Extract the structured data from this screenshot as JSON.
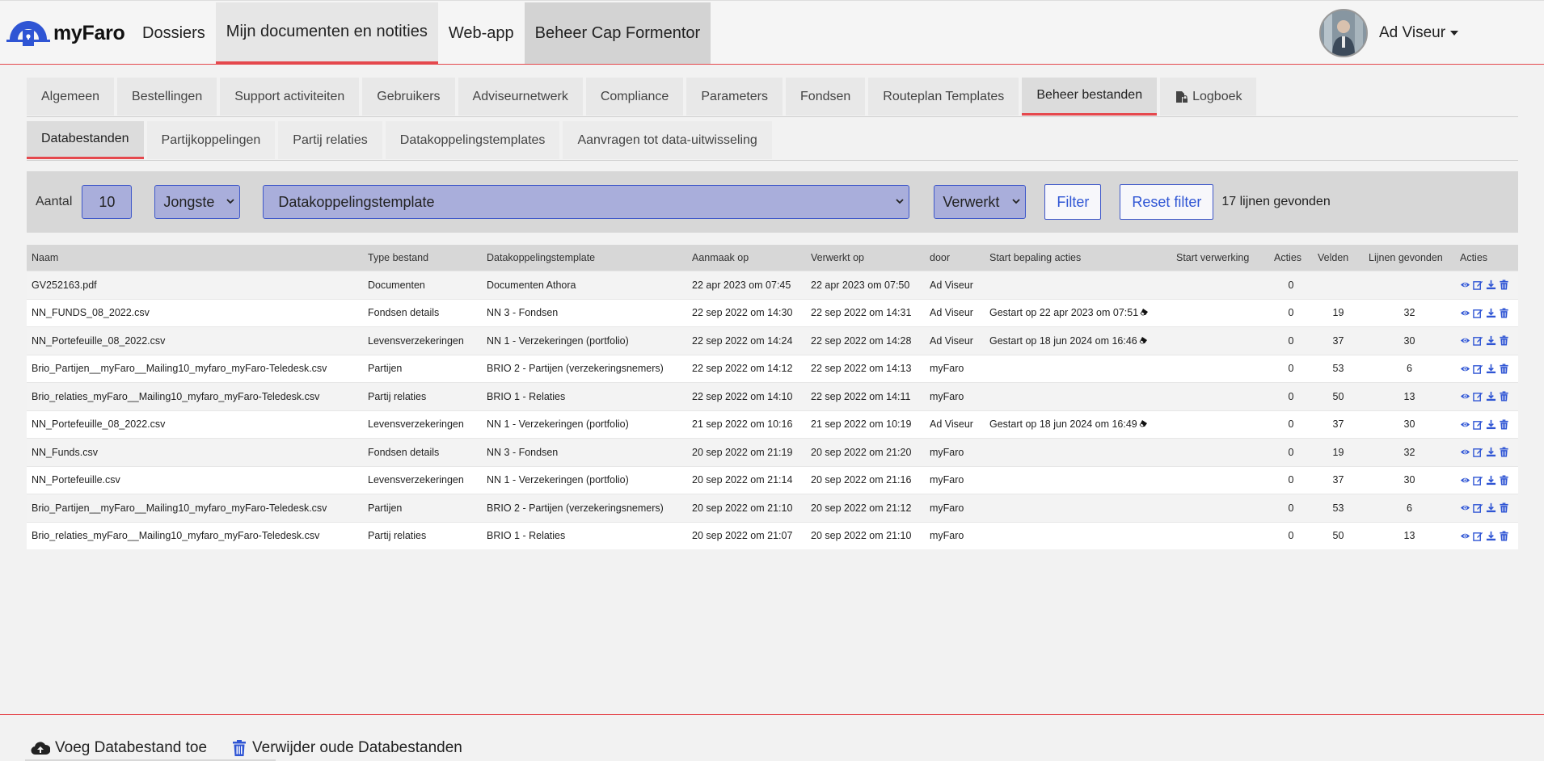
{
  "brand": {
    "name": "myFaro"
  },
  "topnav": {
    "items": [
      "Dossiers",
      "Mijn documenten en notities",
      "Web-app",
      "Beheer Cap Formentor"
    ]
  },
  "user": {
    "name": "Ad Viseur"
  },
  "tabs1": {
    "items": [
      "Algemeen",
      "Bestellingen",
      "Support activiteiten",
      "Gebruikers",
      "Adviseurnetwerk",
      "Compliance",
      "Parameters",
      "Fondsen",
      "Routeplan Templates",
      "Beheer bestanden",
      "Logboek"
    ],
    "active": "Beheer bestanden"
  },
  "tabs2": {
    "items": [
      "Databestanden",
      "Partijkoppelingen",
      "Partij relaties",
      "Datakoppelingstemplates",
      "Aanvragen tot data-uitwisseling"
    ],
    "active": "Databestanden"
  },
  "filter": {
    "aantal_label": "Aantal",
    "aantal_value": "10",
    "sort_value": "Jongste",
    "template_value": "Datakoppelingstemplate",
    "status_value": "Verwerkt",
    "filter_button": "Filter",
    "reset_button": "Reset filter",
    "result_count": "17 lijnen gevonden"
  },
  "table": {
    "headers": [
      "Naam",
      "Type bestand",
      "Datakoppelingstemplate",
      "Aanmaak op",
      "Verwerkt op",
      "door",
      "Start bepaling acties",
      "Start verwerking",
      "Acties",
      "Velden",
      "Lijnen gevonden",
      "Acties"
    ],
    "rows": [
      [
        "GV252163.pdf",
        "Documenten",
        "Documenten Athora",
        "22 apr 2023 om 07:45",
        "22 apr 2023 om 07:50",
        "Ad Viseur",
        "",
        "",
        "0",
        "",
        ""
      ],
      [
        "NN_FUNDS_08_2022.csv",
        "Fondsen details",
        "NN 3 - Fondsen",
        "22 sep 2022 om 14:30",
        "22 sep 2022 om 14:31",
        "Ad Viseur",
        "Gestart op 22 apr 2023 om 07:51",
        "",
        "0",
        "19",
        "32"
      ],
      [
        "NN_Portefeuille_08_2022.csv",
        "Levensverzekeringen",
        "NN 1 - Verzekeringen (portfolio)",
        "22 sep 2022 om 14:24",
        "22 sep 2022 om 14:28",
        "Ad Viseur",
        "Gestart op 18 jun 2024 om 16:46",
        "",
        "0",
        "37",
        "30"
      ],
      [
        "Brio_Partijen__myFaro__Mailing10_myfaro_myFaro-Teledesk.csv",
        "Partijen",
        "BRIO 2 - Partijen (verzekeringsnemers)",
        "22 sep 2022 om 14:12",
        "22 sep 2022 om 14:13",
        "myFaro",
        "",
        "",
        "0",
        "53",
        "6"
      ],
      [
        "Brio_relaties_myFaro__Mailing10_myfaro_myFaro-Teledesk.csv",
        "Partij relaties",
        "BRIO 1 - Relaties",
        "22 sep 2022 om 14:10",
        "22 sep 2022 om 14:11",
        "myFaro",
        "",
        "",
        "0",
        "50",
        "13"
      ],
      [
        "NN_Portefeuille_08_2022.csv",
        "Levensverzekeringen",
        "NN 1 - Verzekeringen (portfolio)",
        "21 sep 2022 om 10:16",
        "21 sep 2022 om 10:19",
        "Ad Viseur",
        "Gestart op 18 jun 2024 om 16:49",
        "",
        "0",
        "37",
        "30"
      ],
      [
        "NN_Funds.csv",
        "Fondsen details",
        "NN 3 - Fondsen",
        "20 sep 2022 om 21:19",
        "20 sep 2022 om 21:20",
        "myFaro",
        "",
        "",
        "0",
        "19",
        "32"
      ],
      [
        "NN_Portefeuille.csv",
        "Levensverzekeringen",
        "NN 1 - Verzekeringen (portfolio)",
        "20 sep 2022 om 21:14",
        "20 sep 2022 om 21:16",
        "myFaro",
        "",
        "",
        "0",
        "37",
        "30"
      ],
      [
        "Brio_Partijen__myFaro__Mailing10_myfaro_myFaro-Teledesk.csv",
        "Partijen",
        "BRIO 2 - Partijen (verzekeringsnemers)",
        "20 sep 2022 om 21:10",
        "20 sep 2022 om 21:12",
        "myFaro",
        "",
        "",
        "0",
        "53",
        "6"
      ],
      [
        "Brio_relaties_myFaro__Mailing10_myfaro_myFaro-Teledesk.csv",
        "Partij relaties",
        "BRIO 1 - Relaties",
        "20 sep 2022 om 21:07",
        "20 sep 2022 om 21:10",
        "myFaro",
        "",
        "",
        "0",
        "50",
        "13"
      ]
    ]
  },
  "footer": {
    "add_label": "Voeg Databestand toe",
    "delete_label": "Verwijder oude Databestanden"
  },
  "icons": {
    "brand": "myfaro-logo-icon",
    "row_actions": [
      "eye-icon",
      "edit-icon",
      "download-icon",
      "trash-icon"
    ],
    "start_bepaling": "eraser-icon",
    "footer_add": "cloud-upload-icon",
    "footer_delete": "trash-icon",
    "logboek_tab": "file-lock-icon"
  },
  "colors": {
    "accent_red": "#e5484d",
    "action_blue": "#2f55d4",
    "select_fill": "#a9aedb"
  }
}
